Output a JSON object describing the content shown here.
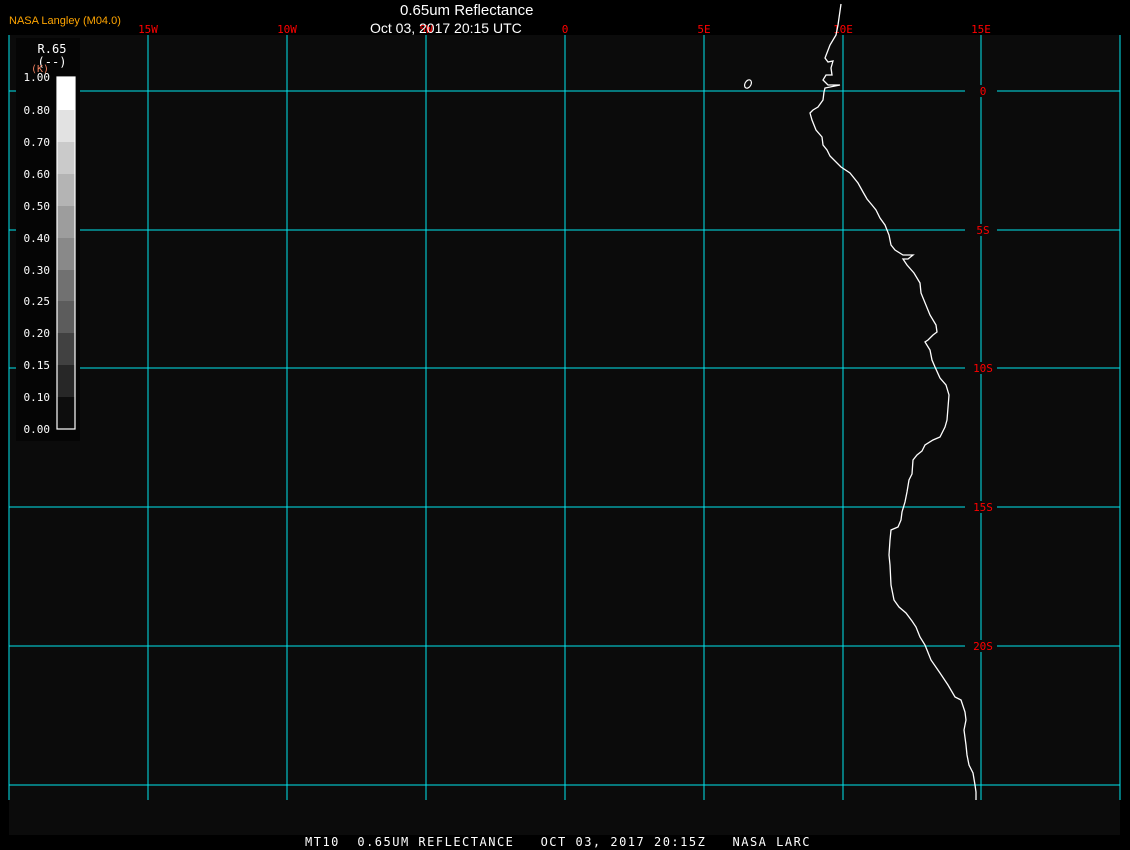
{
  "header": {
    "title": "0.65um Reflectance",
    "timestamp": "Oct 03, 2017 20:15 UTC",
    "brand": "NASA Langley (M04.0)"
  },
  "map": {
    "longitude_labels": [
      "15W",
      "10W",
      "5W",
      "0",
      "5E",
      "10E",
      "15E"
    ],
    "latitude_labels": [
      "0",
      "5S",
      "10S",
      "15S",
      "20S"
    ],
    "grid_color": "#00e5ee",
    "label_color": "#ff0000",
    "coastline_color": "#ffffff",
    "background_color": "#0b0b0b"
  },
  "legend": {
    "variable": "R.65",
    "units": "(--)",
    "unit_extra": "(K)",
    "tick_labels": [
      "1.00",
      "0.80",
      "0.70",
      "0.60",
      "0.50",
      "0.40",
      "0.30",
      "0.25",
      "0.20",
      "0.15",
      "0.10",
      "0.00"
    ],
    "colors": [
      "#ffffff",
      "#e2e2e2",
      "#cacaca",
      "#b4b4b4",
      "#9d9d9d",
      "#898989",
      "#717171",
      "#5c5c5c",
      "#414141",
      "#272727",
      "#0d0d0d"
    ]
  },
  "footer": {
    "text": "MT10  0.65UM REFLECTANCE   OCT 03, 2017 20:15Z   NASA LARC"
  }
}
